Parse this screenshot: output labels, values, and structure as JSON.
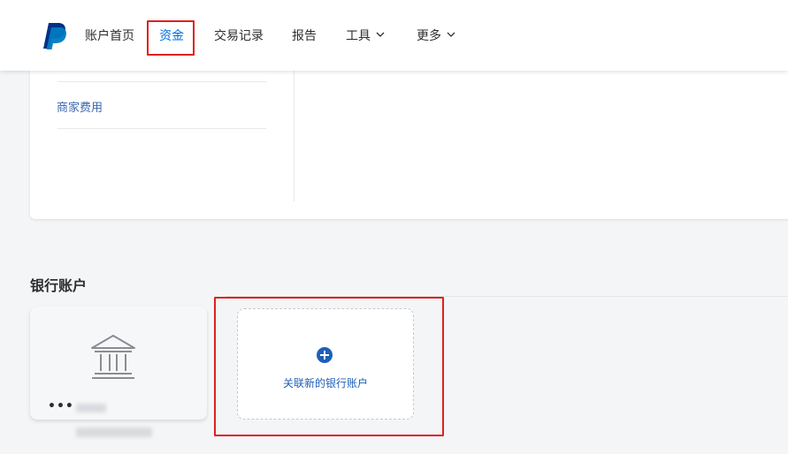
{
  "nav": {
    "items": [
      {
        "label": "账户首页"
      },
      {
        "label": "资金"
      },
      {
        "label": "交易记录"
      },
      {
        "label": "报告"
      },
      {
        "label": "工具"
      },
      {
        "label": "更多"
      }
    ],
    "active_index": 1,
    "icons": {
      "logo": "paypal-logo",
      "dropdown": "chevron-down-icon"
    }
  },
  "top_card": {
    "fees_link": "商家费用"
  },
  "bank_section": {
    "title": "银行账户",
    "account_card": {
      "icon": "bank-icon",
      "masked_number": "•••"
    },
    "link_card": {
      "icon": "plus-circle-icon",
      "label": "关联新的银行账户"
    }
  },
  "colors": {
    "accent": "#0070e0",
    "link": "#1f5fb6",
    "annotation": "#e0211d",
    "page_bg": "#f4f5f7"
  }
}
